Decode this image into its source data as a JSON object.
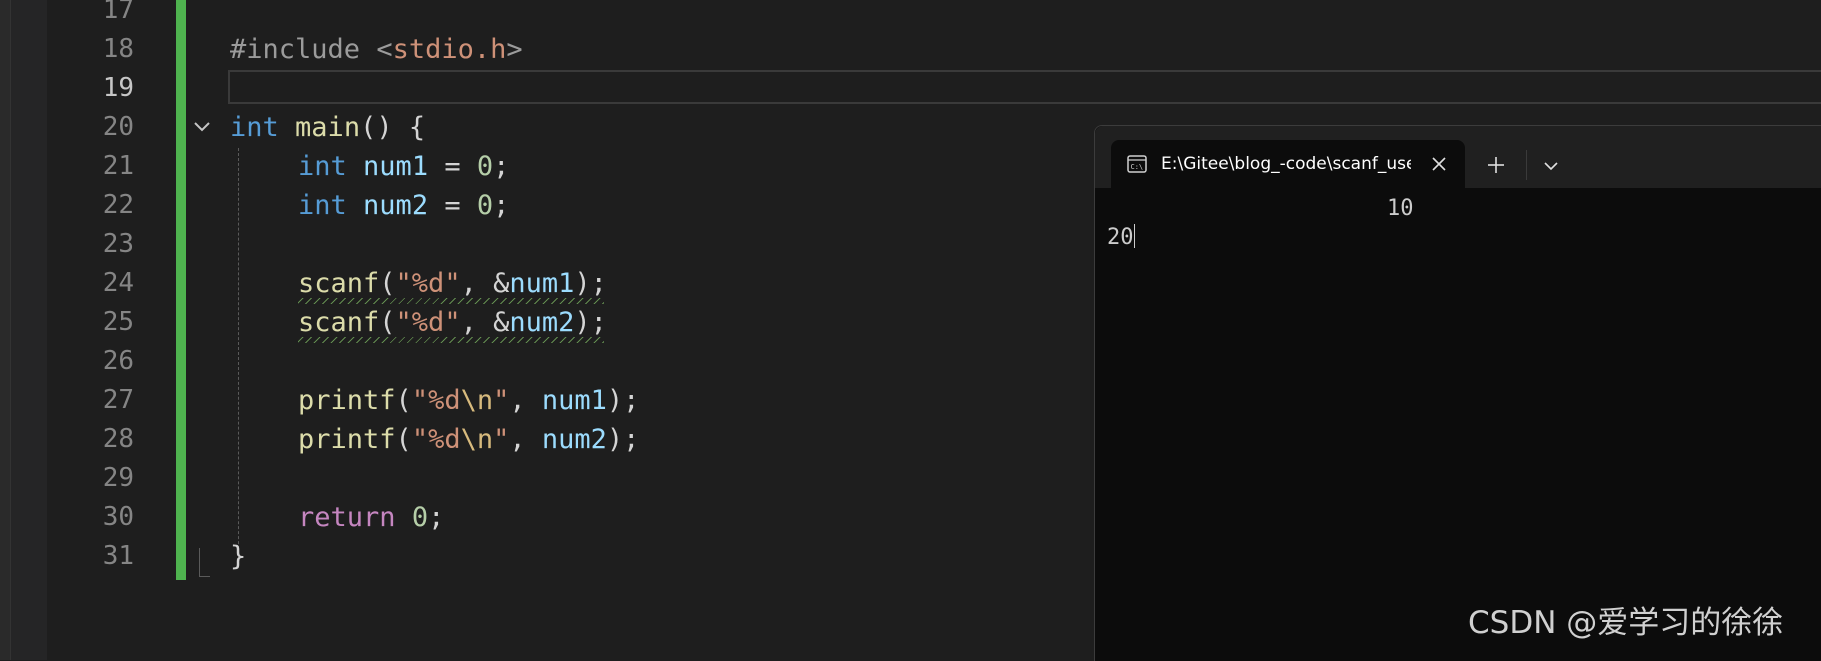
{
  "editor": {
    "line_numbers": [
      "17",
      "18",
      "19",
      "20",
      "21",
      "22",
      "23",
      "24",
      "25",
      "26",
      "27",
      "28",
      "29",
      "30",
      "31"
    ],
    "active_line": "19",
    "code": {
      "l18": {
        "pp": "#include ",
        "open": "<",
        "header": "stdio.h",
        "close": ">"
      },
      "l20": {
        "kw": "int",
        "fn": "main",
        "rest": "() {"
      },
      "l21": {
        "kw": "int",
        "var": "num1",
        "eq": " = ",
        "num": "0",
        "end": ";"
      },
      "l22": {
        "kw": "int",
        "var": "num2",
        "eq": " = ",
        "num": "0",
        "end": ";"
      },
      "l24": {
        "fn": "scanf",
        "p1": "(",
        "str": "\"%d\"",
        "comma": ", &",
        "var": "num1",
        "end": ");"
      },
      "l25": {
        "fn": "scanf",
        "p1": "(",
        "str": "\"%d\"",
        "comma": ", &",
        "var": "num2",
        "end": ");"
      },
      "l27": {
        "fn": "printf",
        "p1": "(",
        "str_a": "\"%d",
        "esc": "\\n",
        "str_b": "\"",
        "comma": ", ",
        "var": "num1",
        "end": ");"
      },
      "l28": {
        "fn": "printf",
        "p1": "(",
        "str_a": "\"%d",
        "esc": "\\n",
        "str_b": "\"",
        "comma": ", ",
        "var": "num2",
        "end": ");"
      },
      "l30": {
        "ctl": "return",
        "sp": " ",
        "num": "0",
        "end": ";"
      },
      "l31": {
        "brace": "}"
      }
    }
  },
  "terminal": {
    "tab_title": "E:\\Gitee\\blog_-code\\scanf_use",
    "icon": "console-icon",
    "output": {
      "line1": "10",
      "line2": "20"
    }
  },
  "watermark": "CSDN @爱学习的徐徐",
  "colors": {
    "accent_gutter": "#4fb34f",
    "keyword": "#569cd6",
    "function": "#dcdcaa",
    "variable": "#9cdcfe",
    "string": "#ce9178",
    "number": "#b5cea8",
    "control": "#c586c0"
  }
}
